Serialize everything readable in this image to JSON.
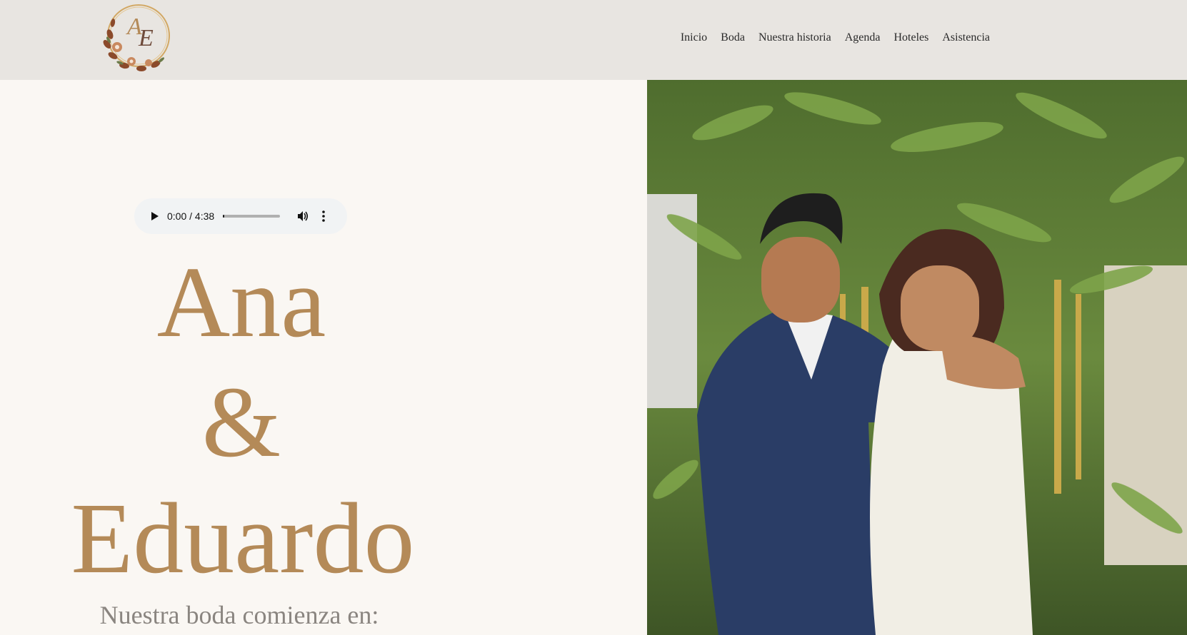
{
  "header": {
    "logo_initials": "AE",
    "nav": [
      {
        "label": "Inicio"
      },
      {
        "label": "Boda"
      },
      {
        "label": "Nuestra historia"
      },
      {
        "label": "Agenda"
      },
      {
        "label": "Hoteles"
      },
      {
        "label": "Asistencia"
      }
    ]
  },
  "audio": {
    "time": "0:00 / 4:38",
    "progress": 0.0
  },
  "hero": {
    "name1": "Ana",
    "amp": "&",
    "name2": "Eduardo",
    "subtitle": "Nuestra boda comienza en:"
  },
  "colors": {
    "header_bg": "#e8e5e1",
    "page_bg": "#faf7f3",
    "accent_gold": "#b48a58",
    "subtitle_gray": "#8a8580"
  },
  "icons": {
    "play": "play-icon",
    "volume": "volume-icon",
    "more": "more-vert-icon"
  }
}
